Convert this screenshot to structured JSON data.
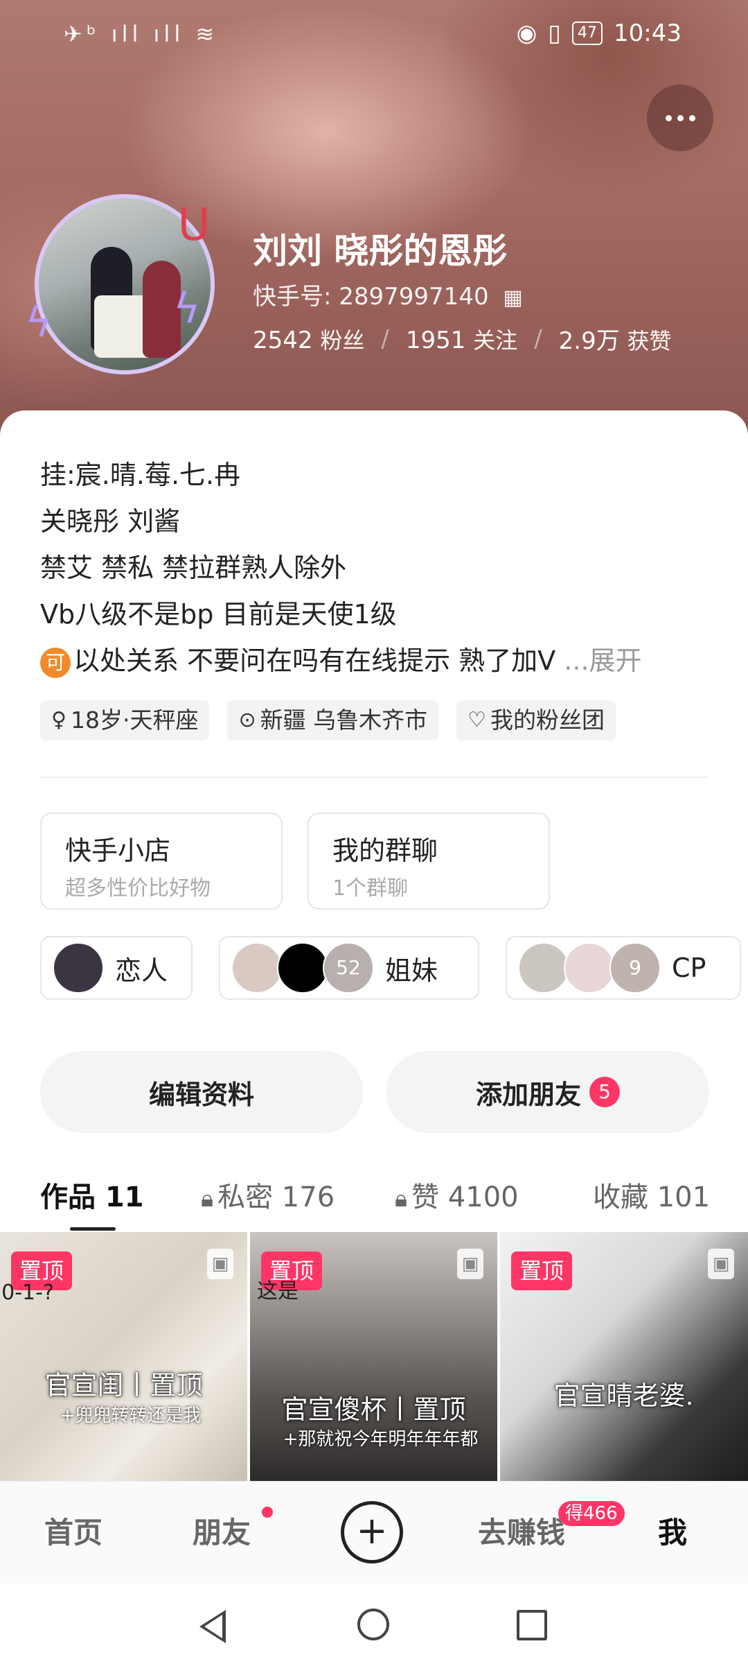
{
  "status_bar": {
    "signal": "✈ᵇ ıll ıll ≋",
    "battery": "47",
    "time": "10:43"
  },
  "profile": {
    "name": "刘刘 晓彤的恩彤",
    "kuaishou_id_label": "快手号: 2897997140",
    "stats": {
      "followers_num": "2542",
      "followers_label": "粉丝",
      "following_num": "1951",
      "following_label": "关注",
      "likes_num": "2.9万",
      "likes_label": "获赞"
    }
  },
  "bio": {
    "lines": [
      "挂:宸.晴.莓.七.冉",
      "关晓彤 刘酱",
      "禁艾 禁私 禁拉群熟人除外",
      "Vb八级不是bp 目前是天使1级",
      "以处关系 不要问在吗有在线提示 熟了加V"
    ],
    "emoji_text": "可",
    "expand_label": "...展开"
  },
  "tags": [
    {
      "icon": "female-icon",
      "label": "18岁·天秤座"
    },
    {
      "icon": "location-icon",
      "label": "新疆 乌鲁木齐市"
    },
    {
      "icon": "heart-icon",
      "label": "我的粉丝团"
    }
  ],
  "services": [
    {
      "title": "快手小店",
      "subtitle": "超多性价比好物"
    },
    {
      "title": "我的群聊",
      "subtitle": "1个群聊"
    }
  ],
  "relations": [
    {
      "label": "恋人"
    },
    {
      "label": "姐妹",
      "count": "52"
    },
    {
      "label": "CP",
      "count": "9"
    }
  ],
  "actions": {
    "edit_label": "编辑资料",
    "add_friend_label": "添加朋友",
    "add_friend_badge": "5"
  },
  "tabs": [
    {
      "label": "作品 11",
      "locked": false
    },
    {
      "label": "私密 176",
      "locked": true
    },
    {
      "label": "赞 4100",
      "locked": true
    },
    {
      "label": "收藏 101",
      "locked": false
    }
  ],
  "posts": [
    {
      "pin": "置顶",
      "caption": "官宣闺丨置顶",
      "sub": "+兜兜转转还是我",
      "corner": "0-1-?"
    },
    {
      "pin": "置顶",
      "caption": "官宣傻杯丨置顶",
      "sub": "+那就祝今年明年年年都",
      "corner": "这是"
    },
    {
      "pin": "置顶",
      "caption": "官宣晴老婆.",
      "sub": "",
      "corner": ""
    }
  ],
  "bottom_nav": {
    "home": "首页",
    "friends": "朋友",
    "earn": "去赚钱",
    "earn_badge": "得466",
    "me": "我",
    "plus": "+"
  },
  "colors": {
    "accent": "#fe3666",
    "banner": "#a36a62"
  }
}
